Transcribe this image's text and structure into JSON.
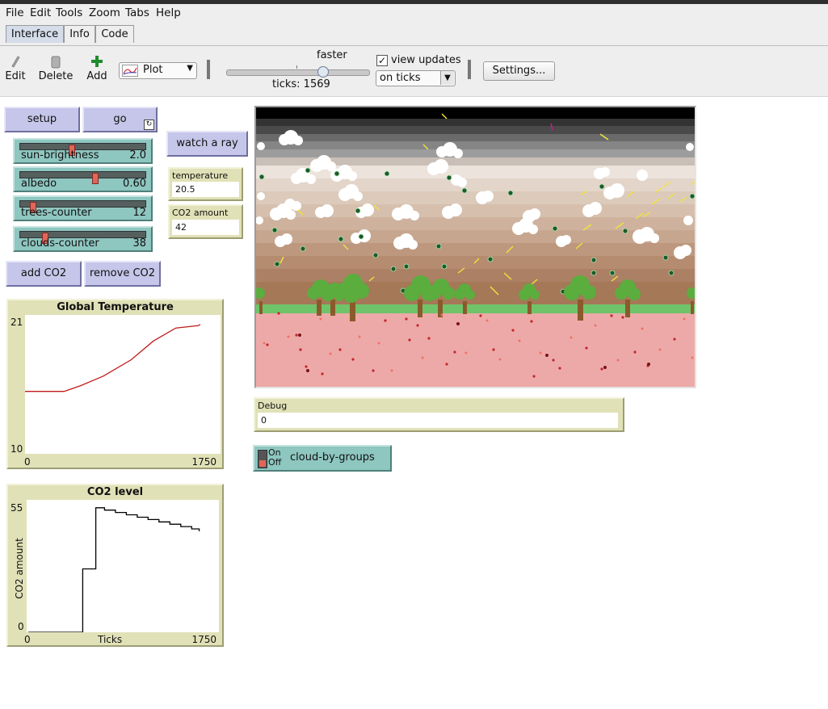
{
  "menu": [
    "File",
    "Edit",
    "Tools",
    "Zoom",
    "Tabs",
    "Help"
  ],
  "tabs": [
    "Interface",
    "Info",
    "Code"
  ],
  "toolbar": {
    "edit": "Edit",
    "delete": "Delete",
    "add": "Add",
    "widget_type": "Plot",
    "speed_label": "faster",
    "speed_fraction": 0.68,
    "ticks": "ticks: 1569",
    "view_updates": "view updates",
    "view_updates_checked": true,
    "update_mode": "on ticks",
    "settings": "Settings..."
  },
  "buttons": {
    "setup": "setup",
    "go": "go",
    "watch": "watch a ray",
    "add_co2": "add CO2",
    "remove_co2": "remove CO2"
  },
  "sliders": [
    {
      "label": "sun-brightness",
      "value": "2.0",
      "fraction": 0.4
    },
    {
      "label": "albedo",
      "value": "0.60",
      "fraction": 0.6
    },
    {
      "label": "trees-counter",
      "value": "12",
      "fraction": 0.08
    },
    {
      "label": "clouds-counter",
      "value": "38",
      "fraction": 0.18
    }
  ],
  "monitors": {
    "temperature": {
      "label": "temperature",
      "value": "20.5"
    },
    "co2": {
      "label": "CO2 amount",
      "value": "42"
    },
    "debug": {
      "label": "Debug",
      "value": "0"
    }
  },
  "switch": {
    "label": "cloud-by-groups",
    "on": "On",
    "off": "Off",
    "state": "off"
  },
  "plots": {
    "temp": {
      "title": "Global Temperature",
      "ymax": "21",
      "ymin": "10",
      "xmin": "0",
      "xmax": "1750",
      "color": "#c21a1a"
    },
    "co2": {
      "title": "CO2 level",
      "ymax": "55",
      "ymin": "0",
      "xmin": "0",
      "xmax": "1750",
      "xlabel": "Ticks",
      "ylabel": "CO2 amount",
      "color": "#000000"
    }
  },
  "chart_data": [
    {
      "type": "line",
      "title": "Global Temperature",
      "xlabel": "",
      "ylabel": "",
      "xlim": [
        0,
        1750
      ],
      "ylim": [
        10,
        21
      ],
      "x": [
        0,
        350,
        500,
        700,
        950,
        1150,
        1350,
        1550,
        1569
      ],
      "y": [
        14.9,
        14.9,
        15.4,
        16.2,
        17.6,
        19.2,
        20.3,
        20.5,
        20.6
      ]
    },
    {
      "type": "line",
      "title": "CO2 level",
      "xlabel": "Ticks",
      "ylabel": "CO2 amount",
      "xlim": [
        0,
        1750
      ],
      "ylim": [
        0,
        55
      ],
      "x": [
        0,
        500,
        500,
        620,
        620,
        700,
        800,
        900,
        1000,
        1100,
        1200,
        1300,
        1400,
        1500,
        1569
      ],
      "y": [
        0,
        0,
        27,
        27,
        53,
        52,
        51,
        50,
        49,
        48,
        47,
        46,
        45,
        44,
        43
      ]
    }
  ]
}
